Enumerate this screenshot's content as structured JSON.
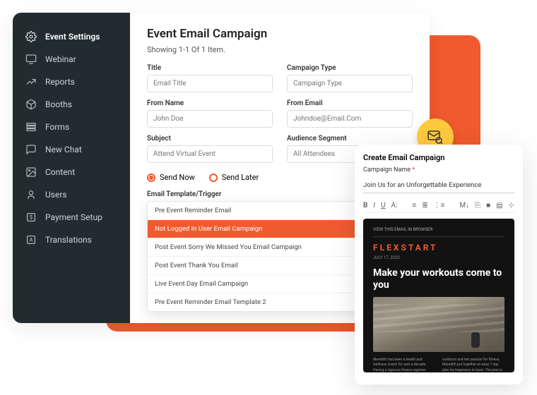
{
  "sidebar": {
    "items": [
      {
        "label": "Event Settings",
        "icon": "gear",
        "active": true
      },
      {
        "label": "Webinar",
        "icon": "monitor"
      },
      {
        "label": "Reports",
        "icon": "chart"
      },
      {
        "label": "Booths",
        "icon": "cube"
      },
      {
        "label": "Forms",
        "icon": "rows"
      },
      {
        "label": "New Chat",
        "icon": "chat"
      },
      {
        "label": "Content",
        "icon": "image"
      },
      {
        "label": "Users",
        "icon": "user"
      },
      {
        "label": "Payment Setup",
        "icon": "dollar"
      },
      {
        "label": "Translations",
        "icon": "font"
      }
    ]
  },
  "main": {
    "title": "Event Email Campaign",
    "subtitle": "Showing 1-1 Of 1 Item.",
    "fields": {
      "title": {
        "label": "Title",
        "placeholder": "Email Title"
      },
      "type": {
        "label": "Campaign Type",
        "placeholder": "Campaign Type"
      },
      "fromName": {
        "label": "From Name",
        "placeholder": "John Doe"
      },
      "fromEmail": {
        "label": "From Email",
        "placeholder": "Johndoe@Email.Com"
      },
      "subject": {
        "label": "Subject",
        "placeholder": "Attend Virtual Event"
      },
      "audience": {
        "label": "Audience Segment",
        "placeholder": "All Attendees"
      }
    },
    "sendNow": "Send Now",
    "sendLater": "Send Later",
    "templateLabel": "Email Template/Trigger",
    "templates": [
      "Pre Event Reminder Email",
      "Not Logged In User Email Campaign",
      "Post Event Sorry We Missed You Email Campaign",
      "Post Event Thank You Email",
      "Live Event Day Email Campaign",
      "Pre Event Reminder Email Template 2"
    ],
    "selectedTemplate": 1
  },
  "rightPanel": {
    "title": "Create Email Campaign",
    "nameLabel": "Campaign Name",
    "nameValue": "Join Us for an Unforgettable Experience",
    "preview": {
      "topBar": "VIEW THIS EMAIL IN BROWSER",
      "brand": "FLEXSTART",
      "date": "JULY 17, 2023",
      "headline": "Make your workouts come to you",
      "col1": "Meredith has been a health and wellness coach for over a decade. Having a rigorous fitness regimen herself, not everyone can get to a gym. By combining her love for the",
      "col2": "outdoors and her passion for fitness, Meredith put together an easy 7 day plan for beginners to learn. The plan is for all levels and includes a combination of cardio."
    }
  }
}
